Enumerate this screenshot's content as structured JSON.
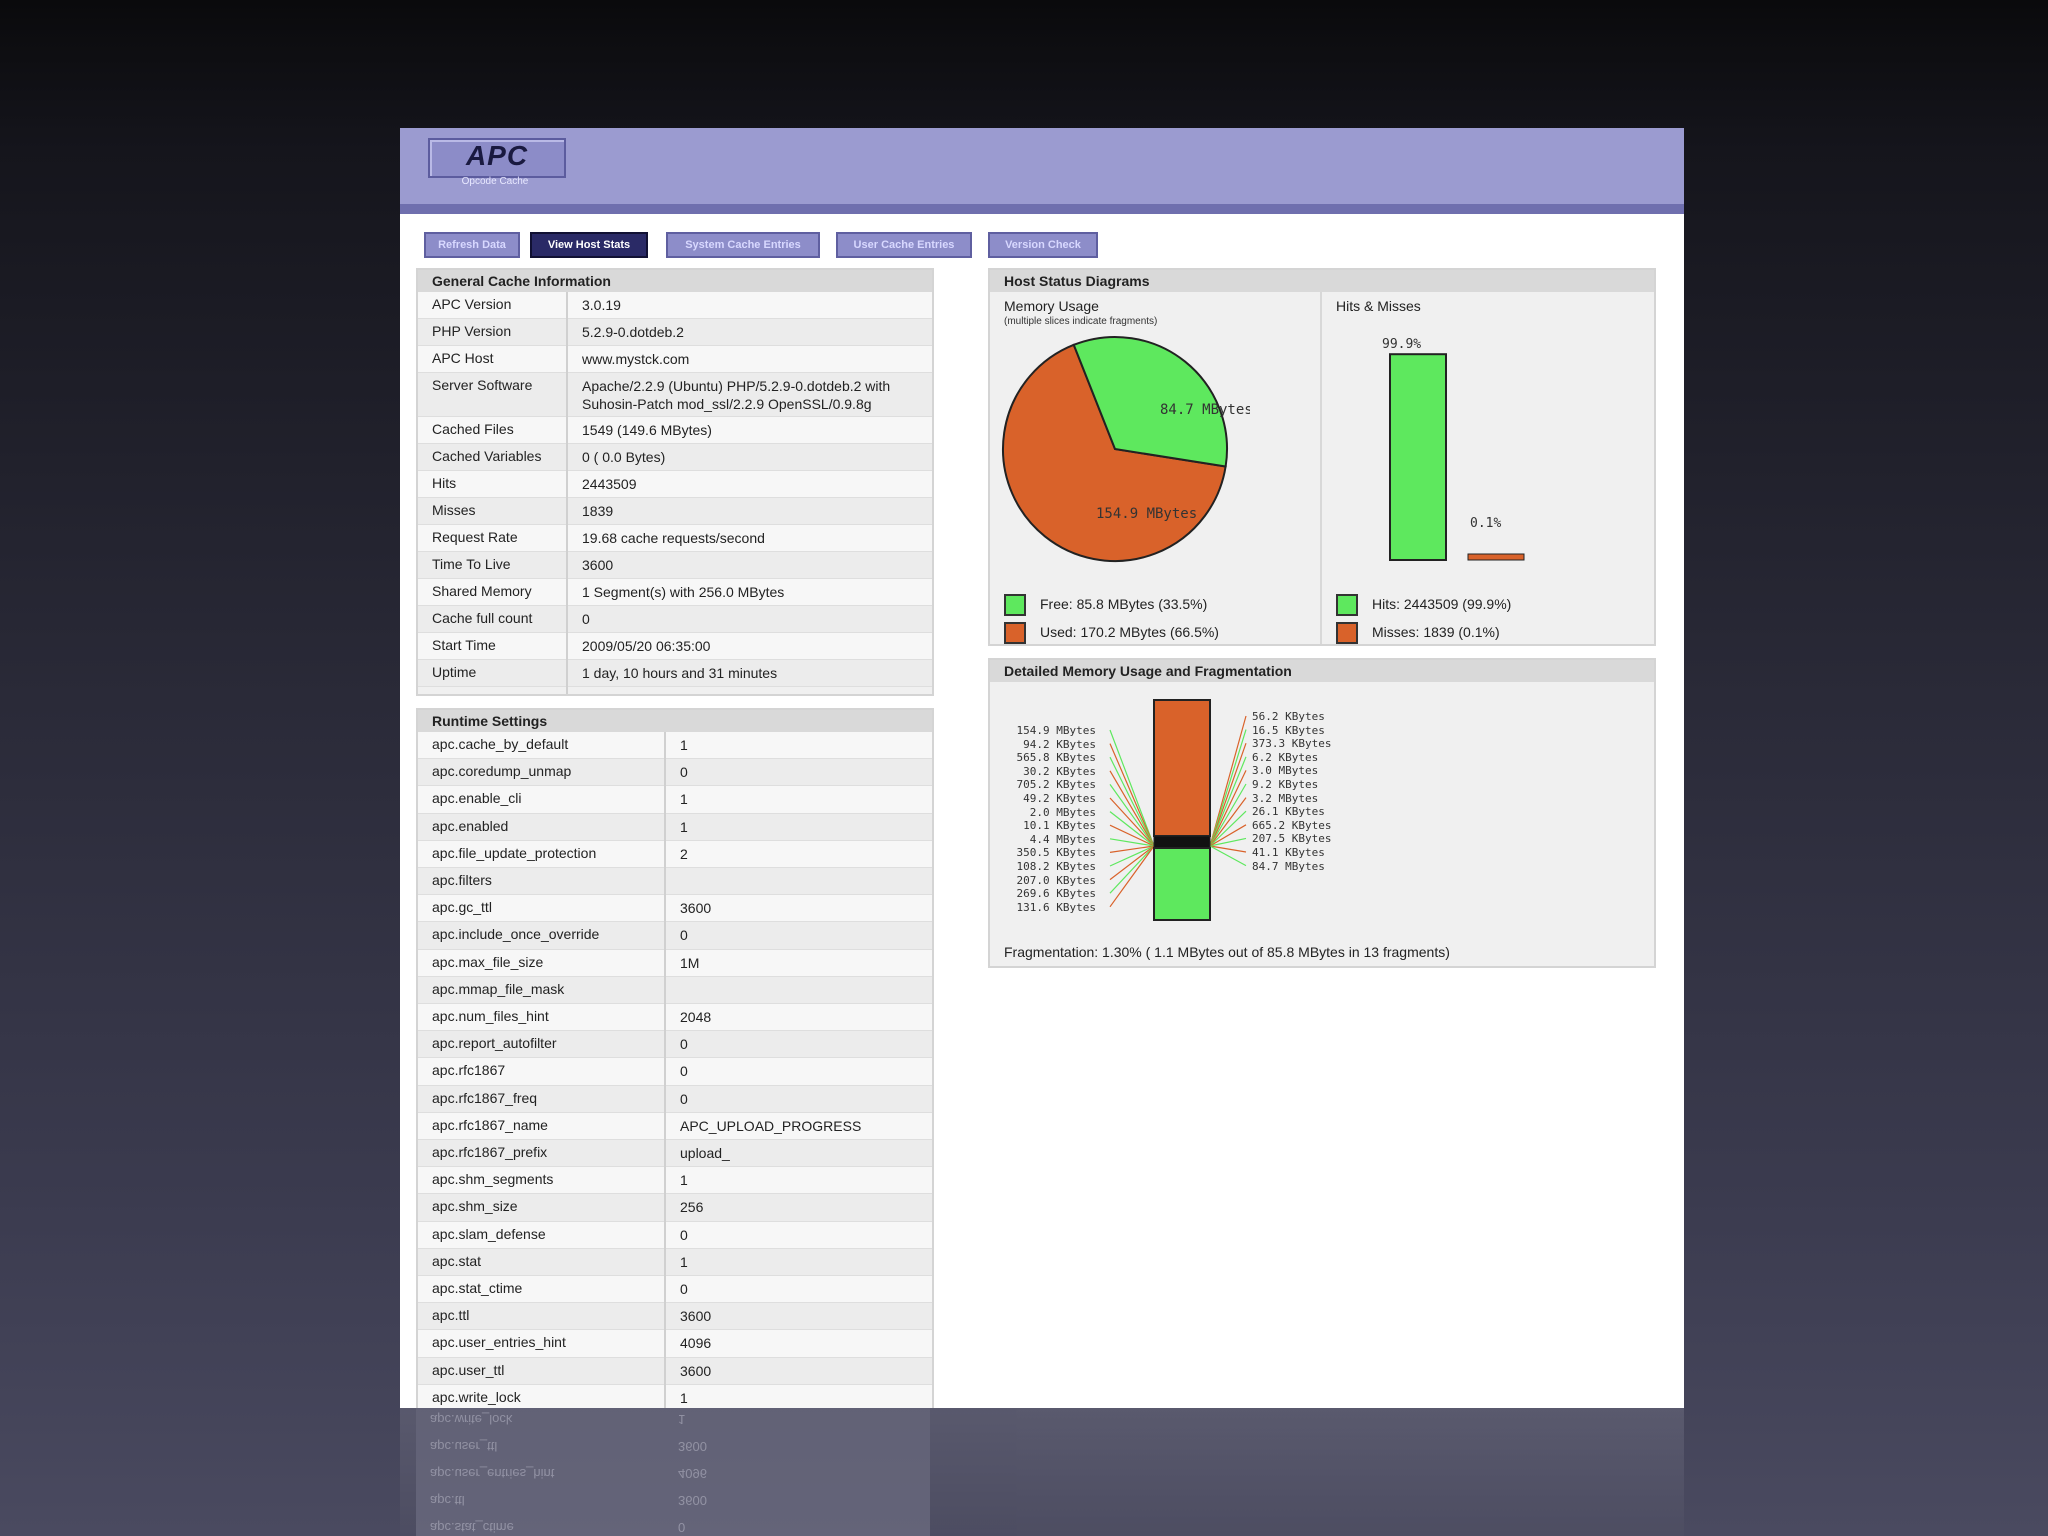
{
  "logo": {
    "title": "APC",
    "subtitle": "Opcode Cache"
  },
  "nav": [
    "Refresh Data",
    "View Host Stats",
    "System Cache Entries",
    "User Cache Entries",
    "Version Check"
  ],
  "general": {
    "title": "General Cache Information",
    "rows": [
      {
        "k": "APC Version",
        "v": "3.0.19"
      },
      {
        "k": "PHP Version",
        "v": "5.2.9-0.dotdeb.2"
      },
      {
        "k": "APC Host",
        "v": "www.mystck.com"
      },
      {
        "k": "Server Software",
        "v": "Apache/2.2.9 (Ubuntu) PHP/5.2.9-0.dotdeb.2 with",
        "v2": "Suhosin-Patch mod_ssl/2.2.9 OpenSSL/0.9.8g"
      },
      {
        "k": "Cached Files",
        "v": "1549 (149.6 MBytes)"
      },
      {
        "k": "Cached Variables",
        "v": "0 ( 0.0 Bytes)"
      },
      {
        "k": "Hits",
        "v": "2443509"
      },
      {
        "k": "Misses",
        "v": "1839"
      },
      {
        "k": "Request Rate",
        "v": "19.68 cache requests/second"
      },
      {
        "k": "Time To Live",
        "v": "3600"
      },
      {
        "k": "Shared Memory",
        "v": "1 Segment(s) with 256.0 MBytes"
      },
      {
        "k": "Cache full count",
        "v": "0"
      },
      {
        "k": "Start Time",
        "v": "2009/05/20 06:35:00"
      },
      {
        "k": "Uptime",
        "v": "1 day, 10 hours and 31 minutes"
      }
    ]
  },
  "runtime": {
    "title": "Runtime Settings",
    "rows": [
      {
        "k": "apc.cache_by_default",
        "v": "1"
      },
      {
        "k": "apc.coredump_unmap",
        "v": "0"
      },
      {
        "k": "apc.enable_cli",
        "v": "1"
      },
      {
        "k": "apc.enabled",
        "v": "1"
      },
      {
        "k": "apc.file_update_protection",
        "v": "2"
      },
      {
        "k": "apc.filters",
        "v": ""
      },
      {
        "k": "apc.gc_ttl",
        "v": "3600"
      },
      {
        "k": "apc.include_once_override",
        "v": "0"
      },
      {
        "k": "apc.max_file_size",
        "v": "1M"
      },
      {
        "k": "apc.mmap_file_mask",
        "v": ""
      },
      {
        "k": "apc.num_files_hint",
        "v": "2048"
      },
      {
        "k": "apc.report_autofilter",
        "v": "0"
      },
      {
        "k": "apc.rfc1867",
        "v": "0"
      },
      {
        "k": "apc.rfc1867_freq",
        "v": "0"
      },
      {
        "k": "apc.rfc1867_name",
        "v": "APC_UPLOAD_PROGRESS"
      },
      {
        "k": "apc.rfc1867_prefix",
        "v": "upload_"
      },
      {
        "k": "apc.shm_segments",
        "v": "1"
      },
      {
        "k": "apc.shm_size",
        "v": "256"
      },
      {
        "k": "apc.slam_defense",
        "v": "0"
      },
      {
        "k": "apc.stat",
        "v": "1"
      },
      {
        "k": "apc.stat_ctime",
        "v": "0"
      },
      {
        "k": "apc.ttl",
        "v": "3600"
      },
      {
        "k": "apc.user_entries_hint",
        "v": "4096"
      },
      {
        "k": "apc.user_ttl",
        "v": "3600"
      },
      {
        "k": "apc.write_lock",
        "v": "1"
      }
    ]
  },
  "host_status": {
    "title": "Host Status Diagrams",
    "memory_title": "Memory Usage",
    "memory_note": "(multiple slices indicate fragments)",
    "hits_title": "Hits & Misses",
    "pie_free_label": "84.7 MBytes",
    "pie_used_label": "154.9 MBytes",
    "free_fraction": 0.335,
    "hits_pct_label": "99.9%",
    "misses_pct_label": "0.1%",
    "hits_fraction": 0.999,
    "legend_free": "Free: 85.8 MBytes (33.5%)",
    "legend_used": "Used: 170.2 MBytes (66.5%)",
    "legend_hits": "Hits: 2443509 (99.9%)",
    "legend_misses": "Misses: 1839 (0.1%)",
    "color_free": "#5ee85e",
    "color_used": "#d9622a"
  },
  "detailed": {
    "title": "Detailed Memory Usage and Fragmentation",
    "left_labels": [
      "154.9 MBytes",
      "94.2 KBytes",
      "565.8 KBytes",
      "30.2 KBytes",
      "705.2 KBytes",
      "49.2 KBytes",
      "2.0 MBytes",
      "10.1 KBytes",
      "4.4 MBytes",
      "350.5 KBytes",
      "108.2 KBytes",
      "207.0 KBytes",
      "269.6 KBytes",
      "131.6 KBytes"
    ],
    "right_labels": [
      "56.2 KBytes",
      "16.5 KBytes",
      "373.3 KBytes",
      "6.2 KBytes",
      "3.0 MBytes",
      "9.2 KBytes",
      "3.2 MBytes",
      "26.1 KBytes",
      "665.2 KBytes",
      "207.5 KBytes",
      "41.1 KBytes",
      "84.7 MBytes"
    ],
    "fragmentation": "Fragmentation: 1.30% ( 1.1 MBytes out of 85.8 MBytes in 13 fragments)"
  },
  "reflection_rows": [
    {
      "k": "apc.write_lock",
      "v": "1"
    },
    {
      "k": "apc.user_ttl",
      "v": "3600"
    },
    {
      "k": "apc.user_entries_hint",
      "v": "4096"
    },
    {
      "k": "apc.ttl",
      "v": "3600"
    },
    {
      "k": "apc.stat_ctime",
      "v": "0"
    }
  ]
}
